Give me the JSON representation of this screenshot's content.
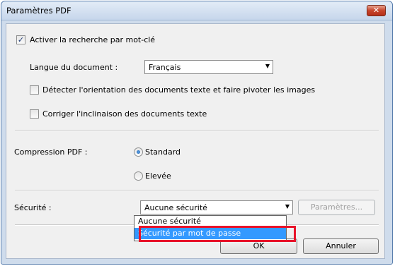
{
  "window": {
    "title": "Paramètres PDF",
    "close_symbol": "✕"
  },
  "keyword_search": {
    "label": "Activer la recherche par mot-clé",
    "checked": true
  },
  "document_language": {
    "label": "Langue du document :",
    "value": "Français"
  },
  "detect_orientation": {
    "label": "Détecter l'orientation des documents texte et faire pivoter les images",
    "checked": false
  },
  "correct_skew": {
    "label": "Corriger l'inclinaison des documents texte",
    "checked": false
  },
  "compression": {
    "label": "Compression PDF :",
    "options": [
      {
        "label": "Standard",
        "selected": true
      },
      {
        "label": "Elevée",
        "selected": false
      }
    ]
  },
  "security": {
    "label": "Sécurité :",
    "value": "Aucune sécurité",
    "settings_button": "Paramètres...",
    "dropdown_items": [
      {
        "label": "Aucune sécurité",
        "selected": false
      },
      {
        "label": "Sécurité par mot de passe",
        "selected": true
      }
    ]
  },
  "buttons": {
    "ok": "OK",
    "cancel": "Annuler"
  },
  "colors": {
    "highlight": "#e8132a",
    "selection": "#3399ff"
  }
}
